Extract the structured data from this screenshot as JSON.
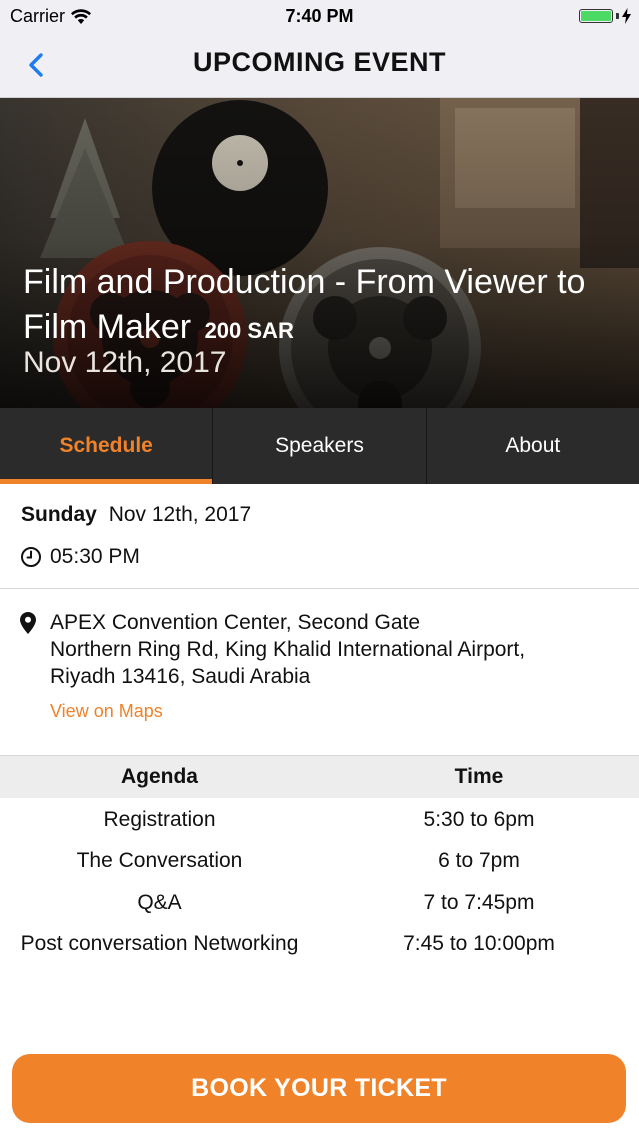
{
  "status_bar": {
    "carrier": "Carrier",
    "time": "7:40 PM",
    "battery_level": 1.0,
    "battery_color": "#4cd964"
  },
  "nav": {
    "title": "UPCOMING EVENT",
    "back_icon": "chevron-left-icon"
  },
  "event": {
    "title": "Film and Production - From Viewer to Film Maker",
    "price": "200 SAR",
    "date": "Nov 12th, 2017"
  },
  "tabs": [
    {
      "label": "Schedule",
      "active": true
    },
    {
      "label": "Speakers",
      "active": false
    },
    {
      "label": "About",
      "active": false
    }
  ],
  "schedule": {
    "day": "Sunday",
    "date": "Nov 12th, 2017",
    "time": "05:30 PM",
    "address_lines": [
      "APEX Convention Center, Second Gate",
      "Northern Ring Rd, King Khalid International Airport,",
      "Riyadh 13416, Saudi Arabia"
    ],
    "maps_link": "View on Maps"
  },
  "agenda": {
    "headers": [
      "Agenda",
      "Time"
    ],
    "rows": [
      {
        "item": "Registration",
        "time": "5:30 to 6pm"
      },
      {
        "item": "The Conversation",
        "time": "6 to 7pm"
      },
      {
        "item": "Q&A",
        "time": "7 to 7:45pm"
      },
      {
        "item": "Post conversation Networking",
        "time": "7:45 to 10:00pm"
      }
    ]
  },
  "book_button": "BOOK YOUR TICKET",
  "colors": {
    "accent": "#f0822a",
    "tab_bar": "#2b2b2b",
    "nav_bg": "#efeff4"
  }
}
